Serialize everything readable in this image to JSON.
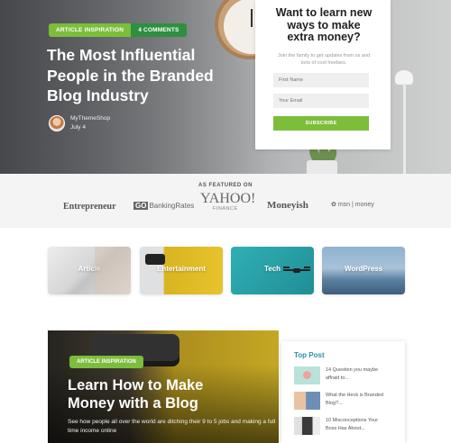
{
  "hero": {
    "category_badge": "Article Inspiration",
    "comments_badge": "4 Comments",
    "title": "The Most Influential People in the Branded Blog Industry",
    "author_name": "MyThemeShop",
    "author_date": "July 4"
  },
  "subscribe": {
    "title": "Want to learn new ways to make extra money?",
    "description": "Join the family to get updates from us and tons of cool freebies.",
    "first_name_placeholder": "First Name",
    "email_placeholder": "Your Email",
    "button_label": "Subscribe"
  },
  "featured_on": {
    "title": "AS FEATURED ON",
    "logos": [
      "Entrepreneur",
      "GO",
      "BankingRates",
      "YAHOO!",
      "FINANCE",
      "Moneyish",
      "msn | money"
    ]
  },
  "categories": [
    "Article",
    "Entertainment",
    "Tech",
    "WordPress"
  ],
  "feature_post": {
    "badge": "Article Inspiration",
    "title": "Learn How to Make Money with a Blog",
    "description": "See how people all over the world are ditching their 9 to 5 jobs and making a full time income online"
  },
  "top_post": {
    "heading": "Top Post",
    "items": [
      {
        "title": "14 Question you maybe affraid to..."
      },
      {
        "title": "What the Heck is Branded Blog?..."
      },
      {
        "title": "10 Misconceptions Your Boss Has About..."
      }
    ]
  },
  "colors": {
    "accent_green": "#7cbd3c",
    "dark_green": "#2e8f3f",
    "top_post_blue": "#2e8fb0"
  }
}
